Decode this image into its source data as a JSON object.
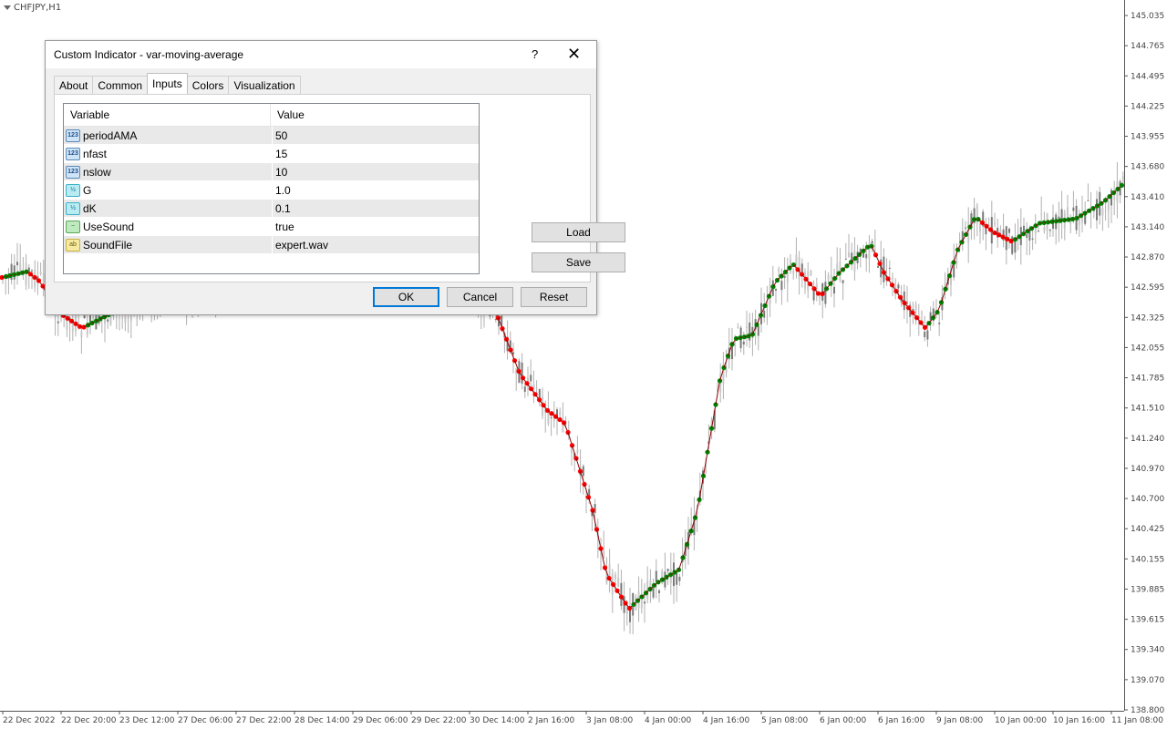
{
  "chart": {
    "symbol": "CHFJPY,H1",
    "price_axis": [
      "145.035",
      "144.765",
      "144.495",
      "144.225",
      "143.955",
      "143.680",
      "143.410",
      "143.140",
      "142.870",
      "142.595",
      "142.325",
      "142.055",
      "141.785",
      "141.510",
      "141.240",
      "140.970",
      "140.700",
      "140.425",
      "140.155",
      "139.885",
      "139.615",
      "139.340",
      "139.070",
      "138.800"
    ],
    "time_axis": [
      "22 Dec 2022",
      "22 Dec 20:00",
      "23 Dec 12:00",
      "27 Dec 06:00",
      "27 Dec 22:00",
      "28 Dec 14:00",
      "29 Dec 06:00",
      "29 Dec 22:00",
      "30 Dec 14:00",
      "2 Jan 16:00",
      "3 Jan 08:00",
      "4 Jan 00:00",
      "4 Jan 16:00",
      "5 Jan 08:00",
      "6 Jan 00:00",
      "6 Jan 16:00",
      "9 Jan 08:00",
      "10 Jan 00:00",
      "10 Jan 16:00",
      "11 Jan 08:00"
    ],
    "colors": {
      "candle": "#9e9e9e",
      "ma_up": "#008000",
      "ma_down": "#ff0000"
    }
  },
  "dialog": {
    "title": "Custom Indicator - var-moving-average",
    "help": "?",
    "close": "✕",
    "tabs": [
      "About",
      "Common",
      "Inputs",
      "Colors",
      "Visualization"
    ],
    "active_tab": "Inputs",
    "columns": [
      "Variable",
      "Value"
    ],
    "rows": [
      {
        "icon": "123",
        "type": "int",
        "name": "periodAMA",
        "value": "50"
      },
      {
        "icon": "123",
        "type": "int",
        "name": "nfast",
        "value": "15"
      },
      {
        "icon": "123",
        "type": "int",
        "name": "nslow",
        "value": "10"
      },
      {
        "icon": "½",
        "type": "dbl",
        "name": "G",
        "value": "1.0"
      },
      {
        "icon": "½",
        "type": "dbl",
        "name": "dK",
        "value": "0.1"
      },
      {
        "icon": "~",
        "type": "bool",
        "name": "UseSound",
        "value": "true"
      },
      {
        "icon": "ab",
        "type": "str",
        "name": "SoundFile",
        "value": "expert.wav"
      }
    ],
    "buttons": {
      "load": "Load",
      "save": "Save",
      "ok": "OK",
      "cancel": "Cancel",
      "reset": "Reset"
    }
  }
}
